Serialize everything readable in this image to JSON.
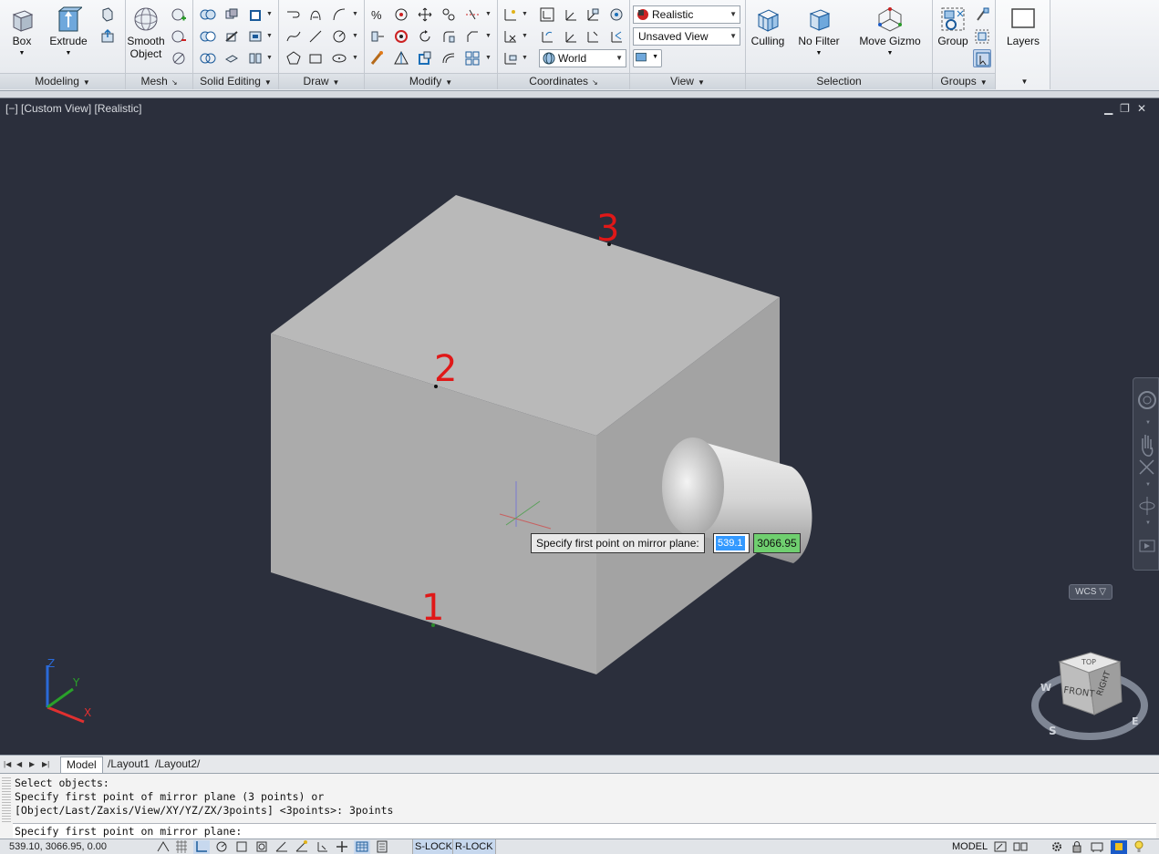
{
  "ribbon": {
    "panels": {
      "modeling": "Modeling",
      "mesh": "Mesh",
      "solid_editing": "Solid Editing",
      "draw": "Draw",
      "modify": "Modify",
      "coordinates": "Coordinates",
      "view": "View",
      "selection": "Selection",
      "groups": "Groups"
    },
    "buttons": {
      "box": "Box",
      "extrude": "Extrude",
      "smooth_object_1": "Smooth",
      "smooth_object_2": "Object",
      "culling": "Culling",
      "no_filter": "No Filter",
      "move_gizmo": "Move Gizmo",
      "group": "Group",
      "layers": "Layers"
    },
    "combos": {
      "visual_style": "Realistic",
      "named_view": "Unsaved View",
      "ucs": "World"
    }
  },
  "viewport": {
    "label": "[−] [Custom View] [Realistic]",
    "wcs_badge": "WCS",
    "annotations": [
      "1",
      "2",
      "3"
    ],
    "viewcube": {
      "top": "TOP",
      "front": "FRONT",
      "right": "RIGHT",
      "compass_w": "W",
      "compass_s": "S",
      "compass_e": "E"
    },
    "ucs_axes": {
      "x": "X",
      "y": "Y",
      "z": "Z"
    }
  },
  "dynamic_input": {
    "prompt": "Specify first point on mirror plane:",
    "x_value": "539.1",
    "y_value": "3066.95"
  },
  "layout_tabs": [
    {
      "label": "Model",
      "active": true
    },
    {
      "label": "Layout1",
      "active": false
    },
    {
      "label": "Layout2",
      "active": false
    }
  ],
  "command": {
    "history": [
      "Select objects:",
      "Specify first point of mirror plane (3 points) or",
      "[Object/Last/Zaxis/View/XY/YZ/ZX/3points] <3points>: 3points"
    ],
    "current": "Specify first point on mirror plane:"
  },
  "status_bar": {
    "coordinates": "539.10, 3066.95, 0.00",
    "slock": "S-LOCK",
    "rlock": "R-LOCK",
    "model": "MODEL"
  }
}
